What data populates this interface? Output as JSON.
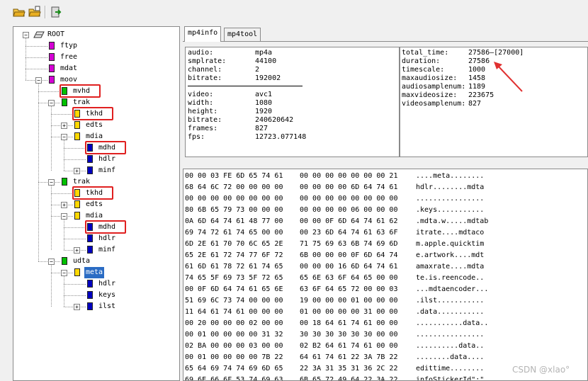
{
  "toolbar": {
    "buttons": [
      {
        "name": "open-file-icon"
      },
      {
        "name": "open-folder-icon"
      },
      {
        "name": "exit-icon"
      }
    ]
  },
  "tree": {
    "nodes": [
      {
        "label": "ROOT",
        "depth": 0,
        "icon": "root-icon",
        "expander": "minus"
      },
      {
        "label": "ftyp",
        "depth": 1,
        "icon": "magenta",
        "expander": ""
      },
      {
        "label": "free",
        "depth": 1,
        "icon": "magenta",
        "expander": ""
      },
      {
        "label": "mdat",
        "depth": 1,
        "icon": "magenta",
        "expander": ""
      },
      {
        "label": "moov",
        "depth": 1,
        "icon": "magenta",
        "expander": "minus"
      },
      {
        "label": "mvhd",
        "depth": 2,
        "icon": "green",
        "expander": "",
        "highlight": true
      },
      {
        "label": "trak",
        "depth": 2,
        "icon": "green",
        "expander": "minus"
      },
      {
        "label": "tkhd",
        "depth": 3,
        "icon": "yellow",
        "expander": "",
        "highlight": true
      },
      {
        "label": "edts",
        "depth": 3,
        "icon": "yellow",
        "expander": "plus"
      },
      {
        "label": "mdia",
        "depth": 3,
        "icon": "yellow",
        "expander": "minus"
      },
      {
        "label": "mdhd",
        "depth": 4,
        "icon": "blue",
        "expander": "",
        "highlight": true
      },
      {
        "label": "hdlr",
        "depth": 4,
        "icon": "blue",
        "expander": ""
      },
      {
        "label": "minf",
        "depth": 4,
        "icon": "blue",
        "expander": "plus"
      },
      {
        "label": "trak",
        "depth": 2,
        "icon": "green",
        "expander": "minus"
      },
      {
        "label": "tkhd",
        "depth": 3,
        "icon": "yellow",
        "expander": "",
        "highlight": true
      },
      {
        "label": "edts",
        "depth": 3,
        "icon": "yellow",
        "expander": "plus"
      },
      {
        "label": "mdia",
        "depth": 3,
        "icon": "yellow",
        "expander": "minus"
      },
      {
        "label": "mdhd",
        "depth": 4,
        "icon": "blue",
        "expander": "",
        "highlight": true
      },
      {
        "label": "hdlr",
        "depth": 4,
        "icon": "blue",
        "expander": ""
      },
      {
        "label": "minf",
        "depth": 4,
        "icon": "blue",
        "expander": "plus"
      },
      {
        "label": "udta",
        "depth": 2,
        "icon": "green",
        "expander": "minus"
      },
      {
        "label": "meta",
        "depth": 3,
        "icon": "yellow",
        "expander": "minus",
        "selected": true
      },
      {
        "label": "hdlr",
        "depth": 4,
        "icon": "blue",
        "expander": ""
      },
      {
        "label": "keys",
        "depth": 4,
        "icon": "blue",
        "expander": ""
      },
      {
        "label": "ilst",
        "depth": 4,
        "icon": "blue",
        "expander": "plus"
      }
    ]
  },
  "tabs": [
    {
      "label": "mp4info",
      "active": true
    },
    {
      "label": "mp4tool",
      "active": false
    }
  ],
  "audio_info": [
    {
      "key": "audio:",
      "value": "mp4a"
    },
    {
      "key": "smplrate:",
      "value": "44100"
    },
    {
      "key": "channel:",
      "value": "2"
    },
    {
      "key": "bitrate:",
      "value": "192002"
    }
  ],
  "video_info": [
    {
      "key": "video:",
      "value": "avc1"
    },
    {
      "key": "width:",
      "value": "1080"
    },
    {
      "key": "height:",
      "value": "1920"
    },
    {
      "key": "bitrate:",
      "value": "240620642"
    },
    {
      "key": "frames:",
      "value": "827"
    },
    {
      "key": "fps:",
      "value": "12723.077148"
    }
  ],
  "summary_info": [
    {
      "key": "total_time:",
      "value": "27586—[27000]"
    },
    {
      "key": "duration:",
      "value": "27586"
    },
    {
      "key": "timescale:",
      "value": "1000"
    },
    {
      "key": "maxaudiosize:",
      "value": "1458"
    },
    {
      "key": "audiosamplenum:",
      "value": "1189"
    },
    {
      "key": "maxvideosize:",
      "value": "223675"
    },
    {
      "key": "videosamplenum:",
      "value": "827"
    }
  ],
  "hex_rows": [
    {
      "a": "00 00 03 FE 6D 65 74 61",
      "b": "00 00 00 00 00 00 00 21",
      "t": "....meta........"
    },
    {
      "a": "68 64 6C 72 00 00 00 00",
      "b": "00 00 00 00 6D 64 74 61",
      "t": "hdlr........mdta"
    },
    {
      "a": "00 00 00 00 00 00 00 00",
      "b": "00 00 00 00 00 00 00 00",
      "t": "................"
    },
    {
      "a": "80 6B 65 79 73 00 00 00",
      "b": "00 00 00 00 06 00 00 00",
      "t": ".keys..........."
    },
    {
      "a": "0A 6D 64 74 61 48 77 00",
      "b": "00 00 0F 6D 64 74 61 62",
      "t": ".mdta.w.....mdtab"
    },
    {
      "a": "69 74 72 61 74 65 00 00",
      "b": "00 23 6D 64 74 61 63 6F",
      "t": "itrate....mdtaco"
    },
    {
      "a": "6D 2E 61 70 70 6C 65 2E",
      "b": "71 75 69 63 6B 74 69 6D",
      "t": "m.apple.quicktim"
    },
    {
      "a": "65 2E 61 72 74 77 6F 72",
      "b": "6B 00 00 00 0F 6D 64 74",
      "t": "e.artwork....mdt"
    },
    {
      "a": "61 6D 61 78 72 61 74 65",
      "b": "00 00 00 16 6D 64 74 61",
      "t": "amaxrate....mdta"
    },
    {
      "a": "74 65 5F 69 73 5F 72 65",
      "b": "65 6E 63 6F 64 65 00 00",
      "t": "te.is.reencode.."
    },
    {
      "a": "00 0F 6D 64 74 61 65 6E",
      "b": "63 6F 64 65 72 00 00 03",
      "t": "...mdtaencoder..."
    },
    {
      "a": "51 69 6C 73 74 00 00 00",
      "b": "19 00 00 00 01 00 00 00",
      "t": ".ilst..........."
    },
    {
      "a": "11 64 61 74 61 00 00 00",
      "b": "01 00 00 00 00 31 00 00",
      "t": ".data..........."
    },
    {
      "a": "00 20 00 00 00 02 00 00",
      "b": "00 18 64 61 74 61 00 00",
      "t": "...........data.."
    },
    {
      "a": "00 01 00 00 00 00 31 32",
      "b": "30 30 30 30 30 30 00 00",
      "t": "................"
    },
    {
      "a": "02 BA 00 00 00 03 00 00",
      "b": "02 B2 64 61 74 61 00 00",
      "t": "..........data.."
    },
    {
      "a": "00 01 00 00 00 00 7B 22",
      "b": "64 61 74 61 22 3A 7B 22",
      "t": "........data...."
    },
    {
      "a": "65 64 69 74 74 69 6D 65",
      "b": "22 3A 31 35 31 36 2C 22",
      "t": "edittime........"
    },
    {
      "a": "69 6E 66 6F 53 74 69 63",
      "b": "6B 65 72 49 64 22 3A 22",
      "t": "infoStickerId\":\""
    }
  ],
  "watermark": "CSDN @xlao°",
  "colors": {
    "highlight_box": "#e02020",
    "selection": "#2b6cc4",
    "arrow": "#e03030"
  }
}
